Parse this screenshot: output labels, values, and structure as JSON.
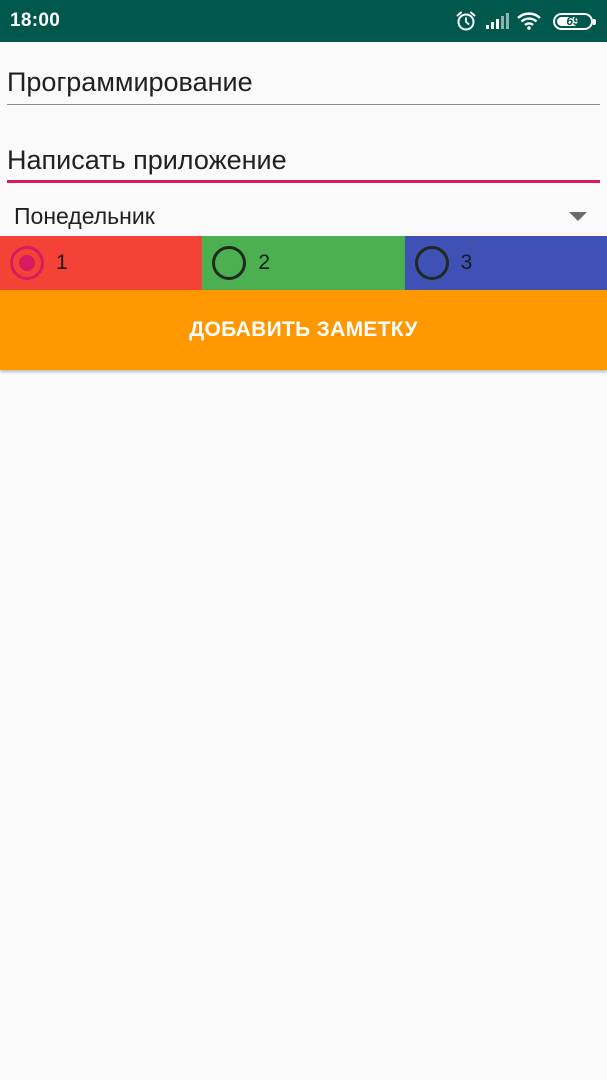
{
  "status_bar": {
    "time": "18:00",
    "battery_percent": 69,
    "battery_label": "69",
    "icons": [
      "alarm-icon",
      "cellular-signal-icon",
      "wifi-icon",
      "battery-icon"
    ],
    "background": "#00574b"
  },
  "form": {
    "field_category": {
      "value": "Программирование"
    },
    "field_note": {
      "value": "Написать приложение",
      "focused": true
    },
    "day_spinner": {
      "selected": "Понедельник",
      "icon": "dropdown-arrow-icon"
    },
    "priority": {
      "options": [
        {
          "label": "1",
          "color": "#f44336",
          "checked": true
        },
        {
          "label": "2",
          "color": "#4caf50",
          "checked": false
        },
        {
          "label": "3",
          "color": "#3f51b5",
          "checked": false
        }
      ]
    },
    "add_button": {
      "label": "ДОБАВИТЬ ЗАМЕТКУ",
      "color": "#ff9800"
    }
  },
  "colors": {
    "accent": "#d81b60",
    "background": "#fafafa"
  }
}
